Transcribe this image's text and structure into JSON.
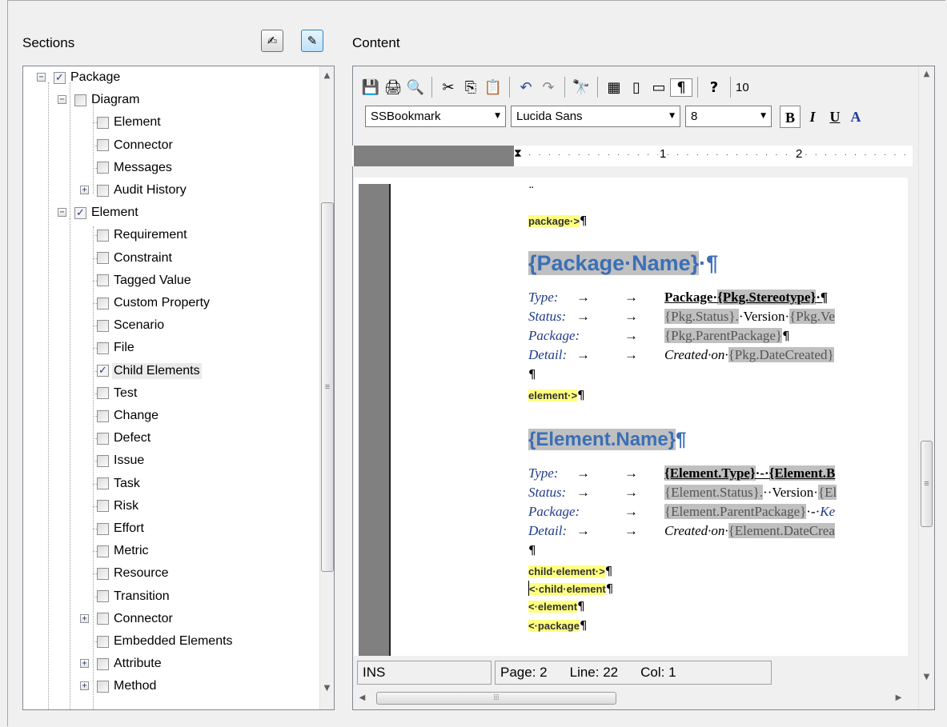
{
  "sections": {
    "label": "Sections",
    "tree": [
      {
        "label": "Package",
        "checked": true,
        "expander": "−",
        "level": 0
      },
      {
        "label": "Diagram",
        "checked": false,
        "expander": "−",
        "level": 1
      },
      {
        "label": "Element",
        "checked": false,
        "level": 2
      },
      {
        "label": "Connector",
        "checked": false,
        "level": 2
      },
      {
        "label": "Messages",
        "checked": false,
        "level": 2
      },
      {
        "label": "Audit History",
        "checked": false,
        "expander": "+",
        "level": 2
      },
      {
        "label": "Element",
        "checked": true,
        "expander": "−",
        "level": 1
      },
      {
        "label": "Requirement",
        "checked": false,
        "level": 2
      },
      {
        "label": "Constraint",
        "checked": false,
        "level": 2
      },
      {
        "label": "Tagged Value",
        "checked": false,
        "level": 2
      },
      {
        "label": "Custom Property",
        "checked": false,
        "level": 2
      },
      {
        "label": "Scenario",
        "checked": false,
        "level": 2
      },
      {
        "label": "File",
        "checked": false,
        "level": 2
      },
      {
        "label": "Child Elements",
        "checked": true,
        "level": 2,
        "selected": true
      },
      {
        "label": "Test",
        "checked": false,
        "level": 2
      },
      {
        "label": "Change",
        "checked": false,
        "level": 2
      },
      {
        "label": "Defect",
        "checked": false,
        "level": 2
      },
      {
        "label": "Issue",
        "checked": false,
        "level": 2
      },
      {
        "label": "Task",
        "checked": false,
        "level": 2
      },
      {
        "label": "Risk",
        "checked": false,
        "level": 2
      },
      {
        "label": "Effort",
        "checked": false,
        "level": 2
      },
      {
        "label": "Metric",
        "checked": false,
        "level": 2
      },
      {
        "label": "Resource",
        "checked": false,
        "level": 2
      },
      {
        "label": "Transition",
        "checked": false,
        "level": 2
      },
      {
        "label": "Connector",
        "checked": false,
        "expander": "+",
        "level": 2
      },
      {
        "label": "Embedded Elements",
        "checked": false,
        "level": 2
      },
      {
        "label": "Attribute",
        "checked": false,
        "expander": "+",
        "level": 2
      },
      {
        "label": "Method",
        "checked": false,
        "expander": "+",
        "level": 2
      }
    ]
  },
  "content": {
    "label": "Content",
    "style_combo": "SSBookmark",
    "font_combo": "Lucida Sans",
    "size_combo": "8",
    "zoom_partial": "10",
    "ruler_marks": [
      "1",
      "2"
    ],
    "doc": {
      "marker_package_open": "package·>",
      "package_heading": "{Package·Name}",
      "pkg_type_label": "Type:",
      "pkg_type_value": "Package·",
      "pkg_type_value2": "{Pkg.Stereotype}",
      "pkg_status_label": "Status:",
      "pkg_status_value": "{Pkg.Status}.",
      "pkg_status_value2": "·Version·",
      "pkg_status_value3": "{Pkg.Ve",
      "pkg_package_label": "Package:",
      "pkg_package_value": "{Pkg.ParentPackage}",
      "pkg_detail_label": "Detail:",
      "pkg_detail_value": "Created·on·",
      "pkg_detail_value2": "{Pkg.DateCreated}",
      "marker_element_open": "element·>",
      "element_heading": "{Element.Name}",
      "el_type_label": "Type:",
      "el_type_value": "{Element.Type}",
      "el_type_value2": "{Element.B",
      "el_status_label": "Status:",
      "el_status_value": "{Element.Status}.",
      "el_status_value2": "··Version·",
      "el_status_value3": "{El",
      "el_package_label": "Package:",
      "el_package_value": "{Element.ParentPackage}",
      "el_package_value2": "Ke",
      "el_detail_label": "Detail:",
      "el_detail_value": "Created·on·",
      "el_detail_value2": "{Element.DateCrea",
      "marker_child_open": "child·element·>",
      "marker_child_close": "<·child·element",
      "marker_element_close": "<·element",
      "marker_package_close": "<·package"
    },
    "status": {
      "mode": "INS",
      "page": "Page: 2",
      "line": "Line: 22",
      "col": "Col: 1"
    }
  }
}
